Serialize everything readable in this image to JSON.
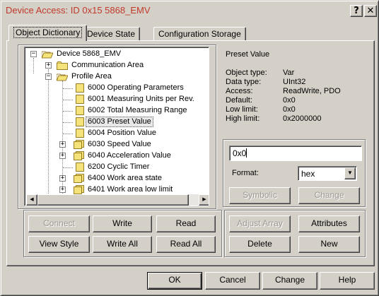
{
  "window": {
    "title": "Device Access: ID 0x15 5868_EMV",
    "help_button": "?",
    "close_button": "✕"
  },
  "tabs": [
    {
      "label": "Object Dictionary",
      "active": true
    },
    {
      "label": "Device State",
      "active": false
    },
    {
      "label": "Configuration Storage",
      "active": false
    }
  ],
  "tree": {
    "items": [
      {
        "label": "Device 5868_EMV",
        "expander": "−",
        "icon": "folder-open-icon"
      },
      {
        "label": "Communication Area",
        "expander": "+",
        "icon": "folder-icon"
      },
      {
        "label": "Profile Area",
        "expander": "−",
        "icon": "folder-open-icon"
      },
      {
        "label": "6000 Operating Parameters",
        "expander": "",
        "icon": "object-icon"
      },
      {
        "label": "6001 Measuring Units per Rev.",
        "expander": "",
        "icon": "object-icon"
      },
      {
        "label": "6002 Total Measuring Range",
        "expander": "",
        "icon": "object-icon"
      },
      {
        "label": "6003 Preset Value",
        "expander": "",
        "icon": "object-icon",
        "selected": true
      },
      {
        "label": "6004 Position Value",
        "expander": "",
        "icon": "object-icon"
      },
      {
        "label": "6030 Speed Value",
        "expander": "+",
        "icon": "object-group-icon"
      },
      {
        "label": "6040 Acceleration Value",
        "expander": "+",
        "icon": "object-group-icon"
      },
      {
        "label": "6200 Cyclic Timer",
        "expander": "",
        "icon": "object-icon"
      },
      {
        "label": "6400 Work area state",
        "expander": "+",
        "icon": "object-group-icon"
      },
      {
        "label": "6401 Work area low limit",
        "expander": "+",
        "icon": "object-group-icon"
      }
    ]
  },
  "properties": {
    "title": "Preset Value",
    "rows": [
      {
        "key": "Object type:",
        "value": "Var"
      },
      {
        "key": "Data type:",
        "value": "UInt32"
      },
      {
        "key": "Access:",
        "value": "ReadWrite, PDO"
      },
      {
        "key": "Default:",
        "value": "0x0"
      },
      {
        "key": "Low limit:",
        "value": "0x0"
      },
      {
        "key": "High limit:",
        "value": "0x2000000"
      }
    ],
    "value_input": "0x0",
    "format_label": "Format:",
    "format_selected": "hex",
    "symbolic_button": "Symbolic",
    "change_inner_button": "Change"
  },
  "left_buttons": {
    "connect": "Connect",
    "write": "Write",
    "read": "Read",
    "view_style": "View Style",
    "write_all": "Write All",
    "read_all": "Read All"
  },
  "right_buttons": {
    "adjust_array": "Adjust Array",
    "attributes": "Attributes",
    "delete": "Delete",
    "new": "New"
  },
  "bottom_buttons": {
    "ok": "OK",
    "cancel": "Cancel",
    "change": "Change",
    "help": "Help"
  },
  "colors": {
    "title_text": "#c0392b",
    "dialog_bg": "#d4d0c8",
    "folder": "#f4e27a",
    "disabled_text": "#9a9890"
  }
}
